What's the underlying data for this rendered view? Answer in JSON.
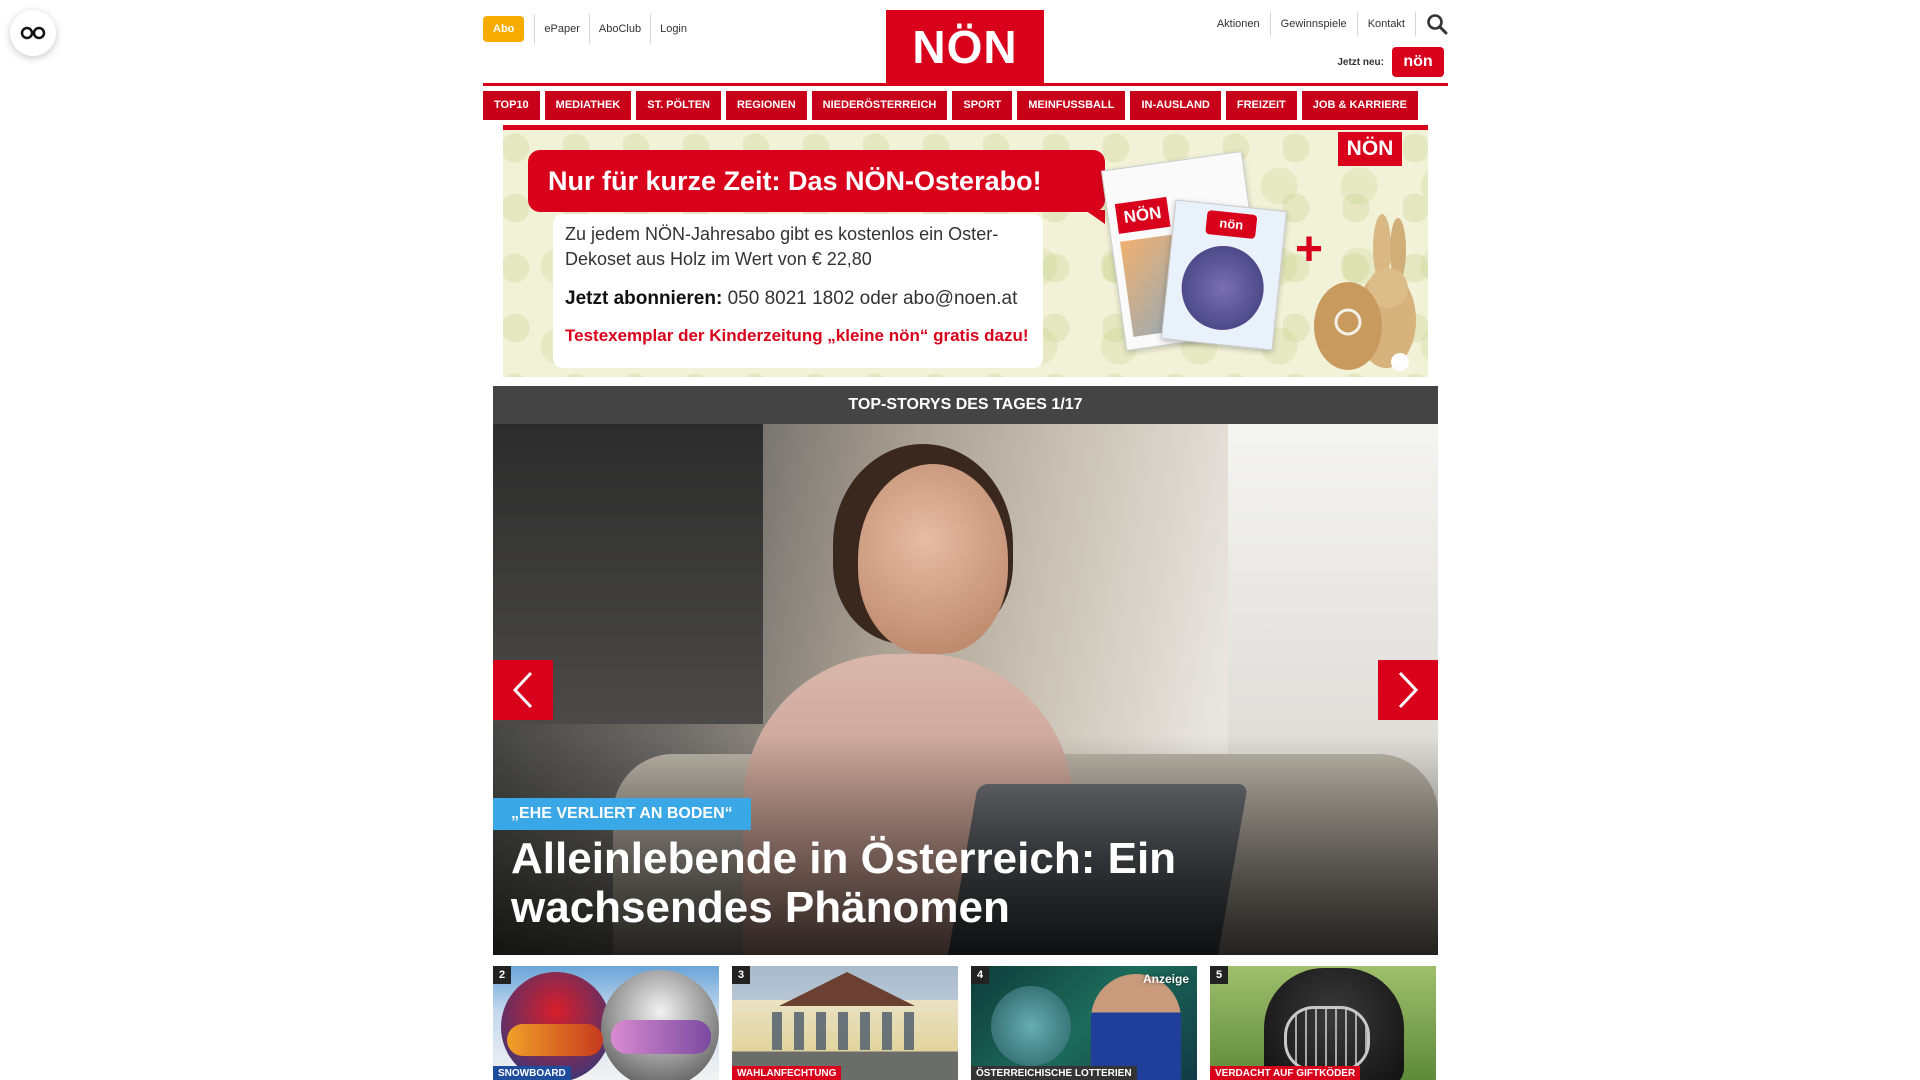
{
  "colors": {
    "brand_red": "#d9001b",
    "abo_orange": "#f5ab00",
    "topstory_bar": "#444444",
    "tag_blue": "#3aa7e6"
  },
  "corner_button": {
    "icon": "reader-glasses-icon"
  },
  "header": {
    "abo_label": "Abo",
    "left_links": [
      "ePaper",
      "AboClub",
      "Login"
    ],
    "logo_text": "NÖN",
    "right_links": [
      "Aktionen",
      "Gewinnspiele",
      "Kontakt"
    ],
    "search_icon": "search-icon",
    "new_label": "Jetzt neu:",
    "kleine_logo_text": "nön"
  },
  "nav": [
    "TOP10",
    "MEDIATHEK",
    "ST. PÖLTEN",
    "REGIONEN",
    "NIEDERÖSTERREICH",
    "SPORT",
    "MEINFUSSBALL",
    "IN-AUSLAND",
    "FREIZEIT",
    "JOB & KARRIERE"
  ],
  "ad": {
    "headline": "Nur für kurze Zeit: Das NÖN-Osterabo!",
    "text": "Zu jedem NÖN-Jahresabo gibt es kostenlos ein Oster-Dekoset aus Holz im Wert von € 22,80",
    "cta_label": "Jetzt abonnieren:",
    "cta_contact": "050 8021 1802 oder abo@noen.at",
    "red_line": "Testexemplar der Kinderzeitung „kleine nön“ gratis dazu!",
    "logo_text": "NÖN",
    "magazine_logo": "NÖN",
    "kids_logo": "nön",
    "plus": "+"
  },
  "top_stories": {
    "bar_label": "TOP-STORYS DES TAGES 1/17",
    "hero": {
      "tag": "„EHE VERLIERT AN BODEN“",
      "title": "Alleinlebende in Österreich: Ein wachsendes Phänomen"
    },
    "thumbs": [
      {
        "num": "2",
        "category": "SNOWBOARD",
        "cat_color": "#1d4d9c",
        "ad": ""
      },
      {
        "num": "3",
        "category": "WAHLANFECHTUNG",
        "cat_color": "#d9001b",
        "ad": ""
      },
      {
        "num": "4",
        "category": "ÖSTERREICHISCHE LOTTERIEN",
        "cat_color": "#333333",
        "ad": "Anzeige"
      },
      {
        "num": "5",
        "category": "VERDACHT AUF GIFTKÖDER",
        "cat_color": "#d9001b",
        "ad": ""
      }
    ]
  }
}
